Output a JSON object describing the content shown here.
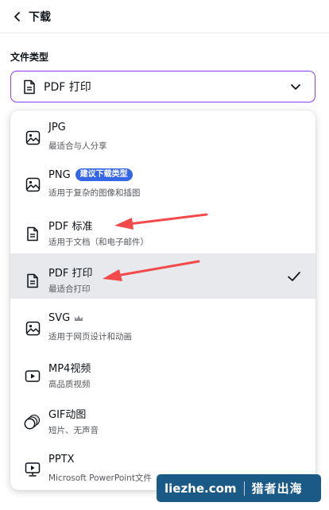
{
  "header": {
    "title": "下载"
  },
  "file_type": {
    "label": "文件类型",
    "selected_value": "PDF 打印"
  },
  "menu": {
    "items": [
      {
        "title": "JPG",
        "subtitle": "最适合与人分享",
        "icon": "image-icon"
      },
      {
        "title": "PNG",
        "subtitle": "适用于复杂的图像和插图",
        "icon": "image-icon",
        "badge": "建议下载类型"
      },
      {
        "title": "PDF 标准",
        "subtitle": "适用于文档（和电子邮件）",
        "icon": "document-icon"
      },
      {
        "title": "PDF 打印",
        "subtitle": "最适合打印",
        "icon": "document-icon",
        "selected": true
      },
      {
        "title": "SVG",
        "subtitle": "适用于网页设计和动画",
        "icon": "image-icon",
        "premium": true
      },
      {
        "title": "MP4视频",
        "subtitle": "高品质视频",
        "icon": "video-icon"
      },
      {
        "title": "GIF动图",
        "subtitle": "短片、无声音",
        "icon": "gif-icon"
      },
      {
        "title": "PPTX",
        "subtitle": "Microsoft PowerPoint文件",
        "icon": "presentation-icon"
      }
    ]
  },
  "watermark": {
    "site": "liezhe.com",
    "brand": "猎者出海"
  },
  "colors": {
    "accent": "#8b3dff",
    "badge": "#3566e6",
    "selected_row": "#e8e9ec",
    "annotation_arrow": "#f04a4a",
    "watermark_bg": "#1b5a86"
  }
}
